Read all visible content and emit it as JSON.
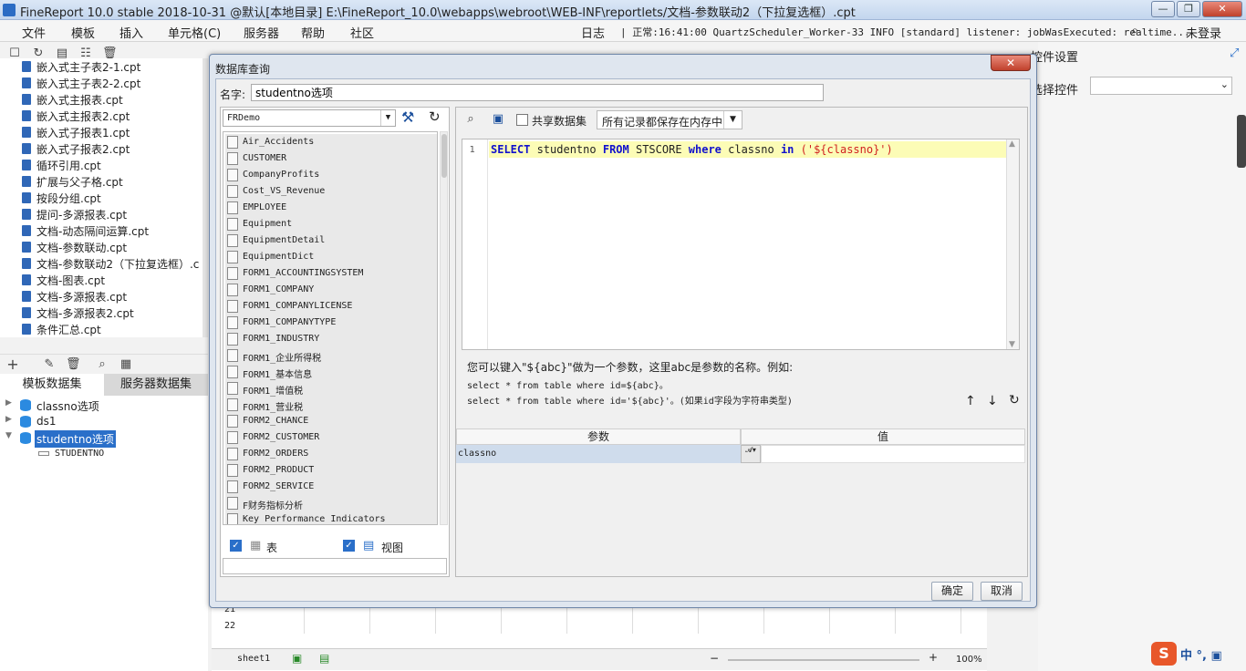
{
  "window": {
    "title": "FineReport 10.0 stable 2018-10-31 @默认[本地目录]    E:\\FineReport_10.0\\webapps\\webroot\\WEB-INF\\reportlets/文档-参数联动2（下拉复选框）.cpt",
    "minimize": "—",
    "maximize": "❐",
    "close": "✕"
  },
  "menu": [
    "文件",
    "模板",
    "插入",
    "单元格(C)",
    "服务器",
    "帮助",
    "社区"
  ],
  "log": {
    "label": "日志",
    "text": "| 正常:16:41:00 QuartzScheduler_Worker-33 INFO [standard] listener: jobWasExecuted: realtime...",
    "login": "未登录"
  },
  "files": [
    "嵌入式主子表2-1.cpt",
    "嵌入式主子表2-2.cpt",
    "嵌入式主报表.cpt",
    "嵌入式主报表2.cpt",
    "嵌入式子报表1.cpt",
    "嵌入式子报表2.cpt",
    "循环引用.cpt",
    "扩展与父子格.cpt",
    "按段分组.cpt",
    "提问-多源报表.cpt",
    "文档-动态隔间运算.cpt",
    "文档-参数联动.cpt",
    "文档-参数联动2（下拉复选框）.c",
    "文档-图表.cpt",
    "文档-多源报表.cpt",
    "文档-多源报表2.cpt",
    "条件汇总.cpt"
  ],
  "dataset_tabs": [
    "模板数据集",
    "服务器数据集"
  ],
  "datasets": [
    "classno选项",
    "ds1",
    "studentno选项"
  ],
  "dataset_field": "STUDENTNO",
  "right_panel": {
    "title": "控件设置",
    "label": "选择控件"
  },
  "sheet": {
    "name": "sheet1",
    "zoom": "100%",
    "rows": [
      "21",
      "22"
    ]
  },
  "dialog": {
    "title": "数据库查询",
    "close": "✕",
    "name_label": "名字:",
    "name_value": "studentno选项",
    "connection": "FRDemo",
    "tables": [
      "Air_Accidents",
      "CUSTOMER",
      "CompanyProfits",
      "Cost_VS_Revenue",
      "EMPLOYEE",
      "Equipment",
      "EquipmentDetail",
      "EquipmentDict",
      "FORM1_ACCOUNTINGSYSTEM",
      "FORM1_COMPANY",
      "FORM1_COMPANYLICENSE",
      "FORM1_COMPANYTYPE",
      "FORM1_INDUSTRY",
      "FORM1_企业所得税",
      "FORM1_基本信息",
      "FORM1_增值税",
      "FORM1_营业税",
      "FORM2_CHANCE",
      "FORM2_CUSTOMER",
      "FORM2_ORDERS",
      "FORM2_PRODUCT",
      "FORM2_SERVICE",
      "F财务指标分析",
      "Key Performance Indicators"
    ],
    "check_table": "表",
    "check_view": "视图",
    "share_label": "共享数据集",
    "memory_option": "所有记录都保存在内存中",
    "line_number": "1",
    "sql": {
      "select": "SELECT",
      "field": " studentno ",
      "from": "FROM",
      "table": " STSCORE ",
      "where": "where",
      "col": " classno ",
      "in": "in",
      "value": " ('${classno}')"
    },
    "hint": {
      "line1": "您可以键入\"${abc}\"做为一个参数，这里abc是参数的名称。例如:",
      "line2": "select * from table where id=${abc}。",
      "line3": "select * from table where id='${abc}'。(如果id字段为字符串类型)"
    },
    "param_header": "参数",
    "value_header": "值",
    "param_name": "classno",
    "param_value": "",
    "ok": "确定",
    "cancel": "取消"
  },
  "colors": {
    "accent": "#2a6fc9",
    "sql_highlight": "#fcfcb6",
    "keyword": "#1111cc",
    "string": "#d02020"
  }
}
